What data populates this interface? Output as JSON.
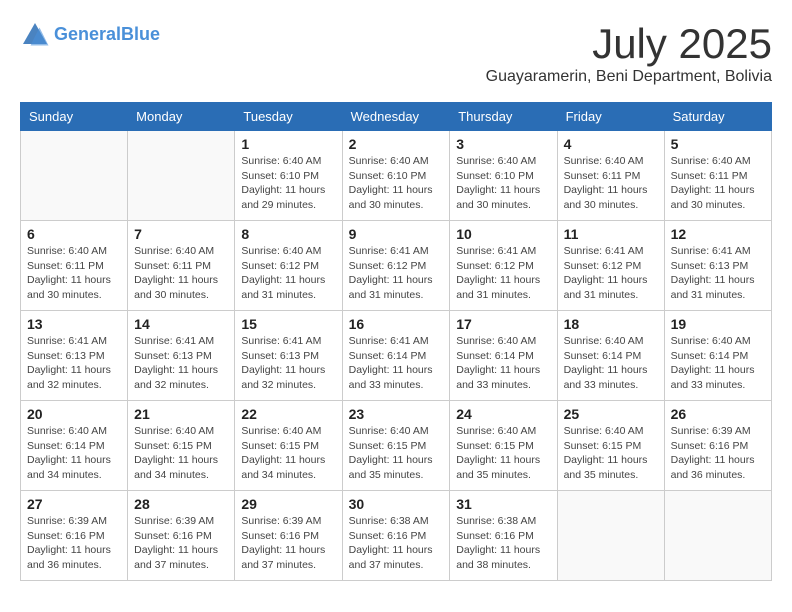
{
  "header": {
    "logo_line1": "General",
    "logo_line2": "Blue",
    "month_year": "July 2025",
    "location": "Guayaramerin, Beni Department, Bolivia"
  },
  "days_of_week": [
    "Sunday",
    "Monday",
    "Tuesday",
    "Wednesday",
    "Thursday",
    "Friday",
    "Saturday"
  ],
  "weeks": [
    [
      {
        "day": "",
        "info": ""
      },
      {
        "day": "",
        "info": ""
      },
      {
        "day": "1",
        "info": "Sunrise: 6:40 AM\nSunset: 6:10 PM\nDaylight: 11 hours and 29 minutes."
      },
      {
        "day": "2",
        "info": "Sunrise: 6:40 AM\nSunset: 6:10 PM\nDaylight: 11 hours and 30 minutes."
      },
      {
        "day": "3",
        "info": "Sunrise: 6:40 AM\nSunset: 6:10 PM\nDaylight: 11 hours and 30 minutes."
      },
      {
        "day": "4",
        "info": "Sunrise: 6:40 AM\nSunset: 6:11 PM\nDaylight: 11 hours and 30 minutes."
      },
      {
        "day": "5",
        "info": "Sunrise: 6:40 AM\nSunset: 6:11 PM\nDaylight: 11 hours and 30 minutes."
      }
    ],
    [
      {
        "day": "6",
        "info": "Sunrise: 6:40 AM\nSunset: 6:11 PM\nDaylight: 11 hours and 30 minutes."
      },
      {
        "day": "7",
        "info": "Sunrise: 6:40 AM\nSunset: 6:11 PM\nDaylight: 11 hours and 30 minutes."
      },
      {
        "day": "8",
        "info": "Sunrise: 6:40 AM\nSunset: 6:12 PM\nDaylight: 11 hours and 31 minutes."
      },
      {
        "day": "9",
        "info": "Sunrise: 6:41 AM\nSunset: 6:12 PM\nDaylight: 11 hours and 31 minutes."
      },
      {
        "day": "10",
        "info": "Sunrise: 6:41 AM\nSunset: 6:12 PM\nDaylight: 11 hours and 31 minutes."
      },
      {
        "day": "11",
        "info": "Sunrise: 6:41 AM\nSunset: 6:12 PM\nDaylight: 11 hours and 31 minutes."
      },
      {
        "day": "12",
        "info": "Sunrise: 6:41 AM\nSunset: 6:13 PM\nDaylight: 11 hours and 31 minutes."
      }
    ],
    [
      {
        "day": "13",
        "info": "Sunrise: 6:41 AM\nSunset: 6:13 PM\nDaylight: 11 hours and 32 minutes."
      },
      {
        "day": "14",
        "info": "Sunrise: 6:41 AM\nSunset: 6:13 PM\nDaylight: 11 hours and 32 minutes."
      },
      {
        "day": "15",
        "info": "Sunrise: 6:41 AM\nSunset: 6:13 PM\nDaylight: 11 hours and 32 minutes."
      },
      {
        "day": "16",
        "info": "Sunrise: 6:41 AM\nSunset: 6:14 PM\nDaylight: 11 hours and 33 minutes."
      },
      {
        "day": "17",
        "info": "Sunrise: 6:40 AM\nSunset: 6:14 PM\nDaylight: 11 hours and 33 minutes."
      },
      {
        "day": "18",
        "info": "Sunrise: 6:40 AM\nSunset: 6:14 PM\nDaylight: 11 hours and 33 minutes."
      },
      {
        "day": "19",
        "info": "Sunrise: 6:40 AM\nSunset: 6:14 PM\nDaylight: 11 hours and 33 minutes."
      }
    ],
    [
      {
        "day": "20",
        "info": "Sunrise: 6:40 AM\nSunset: 6:14 PM\nDaylight: 11 hours and 34 minutes."
      },
      {
        "day": "21",
        "info": "Sunrise: 6:40 AM\nSunset: 6:15 PM\nDaylight: 11 hours and 34 minutes."
      },
      {
        "day": "22",
        "info": "Sunrise: 6:40 AM\nSunset: 6:15 PM\nDaylight: 11 hours and 34 minutes."
      },
      {
        "day": "23",
        "info": "Sunrise: 6:40 AM\nSunset: 6:15 PM\nDaylight: 11 hours and 35 minutes."
      },
      {
        "day": "24",
        "info": "Sunrise: 6:40 AM\nSunset: 6:15 PM\nDaylight: 11 hours and 35 minutes."
      },
      {
        "day": "25",
        "info": "Sunrise: 6:40 AM\nSunset: 6:15 PM\nDaylight: 11 hours and 35 minutes."
      },
      {
        "day": "26",
        "info": "Sunrise: 6:39 AM\nSunset: 6:16 PM\nDaylight: 11 hours and 36 minutes."
      }
    ],
    [
      {
        "day": "27",
        "info": "Sunrise: 6:39 AM\nSunset: 6:16 PM\nDaylight: 11 hours and 36 minutes."
      },
      {
        "day": "28",
        "info": "Sunrise: 6:39 AM\nSunset: 6:16 PM\nDaylight: 11 hours and 37 minutes."
      },
      {
        "day": "29",
        "info": "Sunrise: 6:39 AM\nSunset: 6:16 PM\nDaylight: 11 hours and 37 minutes."
      },
      {
        "day": "30",
        "info": "Sunrise: 6:38 AM\nSunset: 6:16 PM\nDaylight: 11 hours and 37 minutes."
      },
      {
        "day": "31",
        "info": "Sunrise: 6:38 AM\nSunset: 6:16 PM\nDaylight: 11 hours and 38 minutes."
      },
      {
        "day": "",
        "info": ""
      },
      {
        "day": "",
        "info": ""
      }
    ]
  ]
}
